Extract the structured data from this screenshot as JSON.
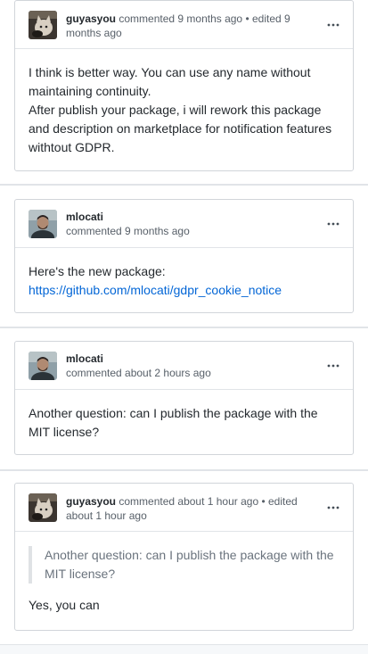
{
  "comments": [
    {
      "author": "guyasyou",
      "meta": "commented 9 months ago • edited 9 months ago",
      "avatar_icon": "cat-avatar-icon",
      "menu_icon": "kebab-icon",
      "paragraphs": [
        "I think is better way. You can use any name without maintaining continuity.",
        "After publish your package, i will rework this package and description on marketplace for notification features withtout GDPR."
      ]
    },
    {
      "author": "mlocati",
      "meta": "commented 9 months ago",
      "avatar_icon": "person-avatar-icon",
      "menu_icon": "kebab-icon",
      "text": "Here's the new package:",
      "link": "https://github.com/mlocati/gdpr_cookie_notice"
    },
    {
      "author": "mlocati",
      "meta": "commented about 2 hours ago",
      "avatar_icon": "person-avatar-icon",
      "menu_icon": "kebab-icon",
      "text": "Another question: can I publish the package with the MIT license?"
    },
    {
      "author": "guyasyou",
      "meta": "commented about 1 hour ago • edited about 1 hour ago",
      "avatar_icon": "cat-avatar-icon",
      "menu_icon": "kebab-icon",
      "quote": "Another question: can I publish the package with the MIT license?",
      "text": "Yes, you can"
    }
  ]
}
